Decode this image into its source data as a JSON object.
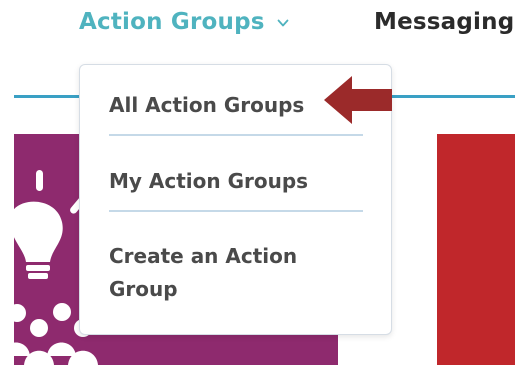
{
  "nav": {
    "tabs": [
      {
        "label": "Action Groups",
        "active": true,
        "icon": "chevron-down-icon"
      },
      {
        "label": "Messaging",
        "active": false
      }
    ],
    "accent_color": "#4fb3bf",
    "rule_color": "#3aa0c4"
  },
  "dropdown": {
    "items": [
      {
        "label": "All Action Groups",
        "highlighted": true
      },
      {
        "label": "My Action Groups"
      },
      {
        "label": "Create an Action Group"
      }
    ]
  },
  "annotation": {
    "icon": "arrow-left-icon",
    "color": "#9b2a2a"
  },
  "cards": [
    {
      "color": "#8e2a6e",
      "icon": "lightbulb-people-icon"
    },
    {
      "color": "#c0272b"
    }
  ]
}
